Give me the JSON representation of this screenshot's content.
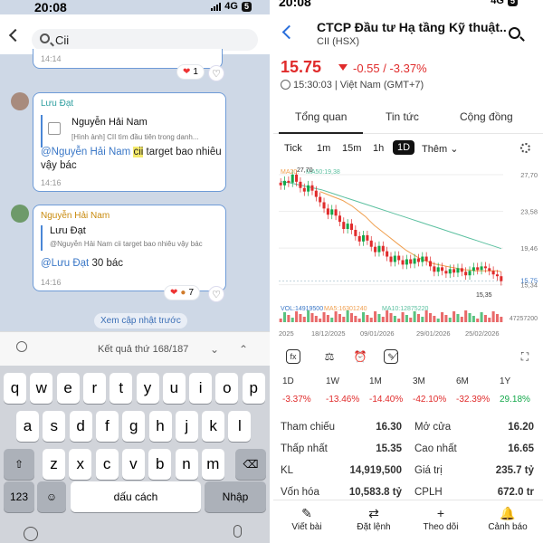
{
  "status": {
    "time": "20:08",
    "network": "4G",
    "battery": "5"
  },
  "chat": {
    "search_query": "Cii",
    "msg0": {
      "time": "14:14",
      "reaction_count": "1"
    },
    "msg1": {
      "sender": "Lưu Đạt",
      "quote_name": "Nguyễn Hải Nam",
      "quote_text": "[Hình ảnh] CII tìm đầu tiên trong danh...",
      "mention": "@Nguyễn Hải Nam",
      "highlight": "cii",
      "body": " target bao nhiêu vậy bác",
      "time": "14:16"
    },
    "msg2": {
      "sender": "Nguyễn Hải Nam",
      "quote_name": "Lưu Đạt",
      "quote_text": "@Nguyễn Hải Nam cii target bao nhiêu vậy bác",
      "mention": "@Lưu Đạt",
      "body": " 30 bác",
      "time": "14:16",
      "reaction_count": "7"
    },
    "more_previous": "Xem cập nhật trước",
    "result_text": "Kết quả thứ 168/187"
  },
  "keyboard": {
    "row1": [
      "q",
      "w",
      "e",
      "r",
      "t",
      "y",
      "u",
      "i",
      "o",
      "p"
    ],
    "row2": [
      "a",
      "s",
      "d",
      "f",
      "g",
      "h",
      "j",
      "k",
      "l"
    ],
    "row3": [
      "z",
      "x",
      "c",
      "v",
      "b",
      "n",
      "m"
    ],
    "num": "123",
    "space": "dấu cách",
    "enter": "Nhập"
  },
  "stock": {
    "title": "CTCP Đầu tư Hạ tầng Kỹ thuật...",
    "subtitle": "CII (HSX)",
    "price": "15.75",
    "change": "-0.55 / -3.37%",
    "time": "15:30:03 | Việt Nam (GMT+7)",
    "tabs": [
      "Tổng quan",
      "Tin tức",
      "Cộng đồng"
    ],
    "ranges": [
      "Tick",
      "1m",
      "15m",
      "1h",
      "1D",
      "Thêm"
    ],
    "perf_labels": [
      "1D",
      "1W",
      "1M",
      "3M",
      "6M",
      "1Y"
    ],
    "perf_values": [
      "-3.37%",
      "-13.46%",
      "-14.40%",
      "-42.10%",
      "-32.39%",
      "29.18%"
    ],
    "stats": {
      "tham_chieu_label": "Tham chiếu",
      "tham_chieu": "16.30",
      "mo_cua_label": "Mở cửa",
      "mo_cua": "16.20",
      "thap_nhat_label": "Thấp nhất",
      "thap_nhat": "15.35",
      "cao_nhat_label": "Cao nhất",
      "cao_nhat": "16.65",
      "kl_label": "KL",
      "kl": "14,919,500",
      "gia_tri_label": "Giá trị",
      "gia_tri": "235.7 tỷ",
      "von_hoa_label": "Vốn hóa",
      "von_hoa": "10,583.8 tỷ",
      "cplh_label": "CPLH",
      "cplh": "672.0 tr"
    },
    "nav": [
      "Viết bài",
      "Đặt lệnh",
      "Theo dõi",
      "Cảnh báo"
    ]
  },
  "chart_data": {
    "type": "line",
    "y_ticks": [
      "27,70",
      "23,58",
      "19,46",
      "15,34",
      "15,75"
    ],
    "x_ticks": [
      "2025",
      "18/12/2025",
      "09/01/2026",
      "29/01/2026",
      "25/02/2026"
    ],
    "ma_labels": [
      "MA20:",
      "MA50:19,38"
    ],
    "high_label": "27,70",
    "low_label": "15,35",
    "vol_labels": [
      "VOL:14919500",
      "MA5:16301240",
      "MA10:12875220"
    ],
    "vol_max_label": "47257200",
    "close": [
      26.5,
      27.0,
      26.8,
      27.7,
      26.9,
      26.2,
      25.8,
      26.5,
      25.9,
      25.2,
      24.6,
      23.9,
      23.2,
      23.8,
      23.1,
      22.4,
      21.6,
      22.2,
      21.5,
      20.8,
      20.2,
      20.9,
      20.3,
      19.6,
      19.0,
      19.7,
      19.1,
      18.5,
      17.9,
      18.6,
      18.1,
      17.6,
      18.2,
      17.7,
      18.3,
      17.9,
      18.5,
      18.0,
      17.4,
      16.8,
      17.3,
      16.9,
      16.6,
      17.1,
      16.7,
      17.2,
      16.8,
      16.4,
      16.9,
      17.3,
      17.0,
      17.4,
      17.2,
      16.9,
      16.5,
      16.3,
      15.75
    ],
    "ma20": [
      25.8,
      25.6,
      25.4,
      25.2,
      25.0,
      24.8,
      24.5,
      24.2,
      23.8,
      23.4,
      23.0,
      22.5,
      22.0,
      21.6,
      21.2,
      20.8,
      20.4,
      20.0,
      19.6,
      19.2,
      18.9,
      18.6,
      18.3,
      18.1,
      17.9,
      17.7,
      17.6,
      17.5,
      17.4,
      17.3,
      17.2,
      17.1,
      17.0,
      17.0,
      16.9,
      16.9,
      16.9,
      16.9,
      16.9,
      16.9,
      16.8
    ],
    "ma50": [
      26.9,
      26.8,
      26.6,
      26.4,
      26.2,
      26.0,
      25.7,
      25.4,
      25.1,
      24.8,
      24.5,
      24.2,
      23.9,
      23.6,
      23.3,
      23.0,
      22.7,
      22.4,
      22.1,
      21.8,
      21.5,
      21.2,
      20.9,
      20.6,
      20.3,
      20.0,
      19.7,
      19.4
    ],
    "ylim": [
      15.0,
      28.0
    ]
  }
}
